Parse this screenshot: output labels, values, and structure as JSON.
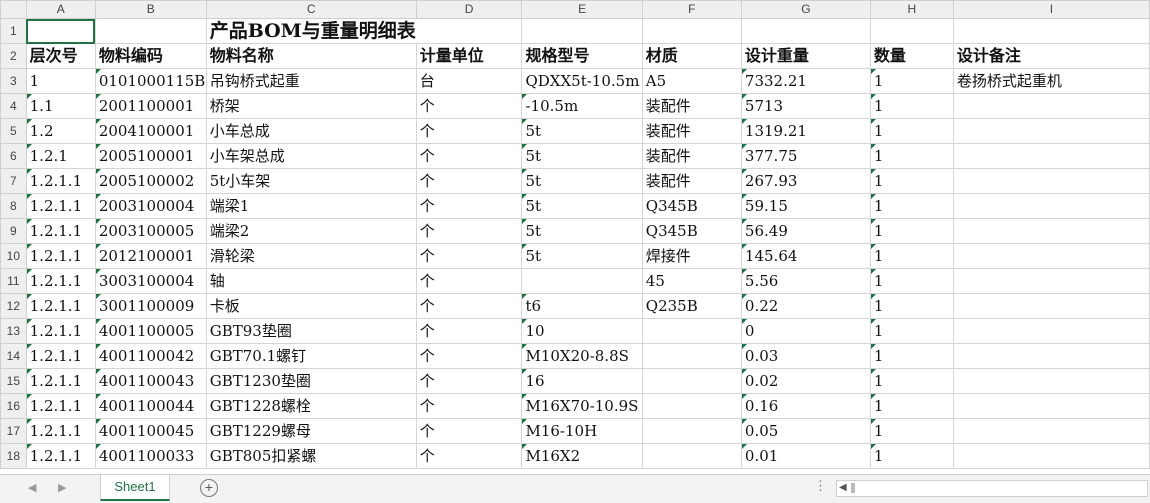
{
  "columns": [
    "A",
    "B",
    "C",
    "D",
    "E",
    "F",
    "G",
    "H",
    "I"
  ],
  "title": "产品BOM与重量明细表",
  "headers": [
    "层次号",
    "物料编码",
    "物料名称",
    "计量单位",
    "规格型号",
    "材质",
    "设计重量",
    "数量",
    "设计备注"
  ],
  "rows": [
    [
      "1",
      "0101000115B",
      "吊钩桥式起重",
      "台",
      "QDXX5t-10.5m",
      "A5",
      "7332.21",
      "1",
      "卷扬桥式起重机"
    ],
    [
      "1.1",
      "2001100001",
      "桥架",
      "个",
      "-10.5m",
      "装配件",
      "5713",
      "1",
      ""
    ],
    [
      "1.2",
      "2004100001",
      "小车总成",
      "个",
      "5t",
      "装配件",
      "1319.21",
      "1",
      ""
    ],
    [
      "1.2.1",
      "2005100001",
      "小车架总成",
      "个",
      "5t",
      "装配件",
      "377.75",
      "1",
      ""
    ],
    [
      "1.2.1.1",
      "2005100002",
      "5t小车架",
      "个",
      "5t",
      "装配件",
      "267.93",
      "1",
      ""
    ],
    [
      "1.2.1.1",
      "2003100004",
      "端梁1",
      "个",
      "5t",
      "Q345B",
      "59.15",
      "1",
      ""
    ],
    [
      "1.2.1.1",
      "2003100005",
      "端梁2",
      "个",
      "5t",
      "Q345B",
      "56.49",
      "1",
      ""
    ],
    [
      "1.2.1.1",
      "2012100001",
      "滑轮梁",
      "个",
      "5t",
      "焊接件",
      "145.64",
      "1",
      ""
    ],
    [
      "1.2.1.1",
      "3003100004",
      "轴",
      "个",
      "",
      "45",
      "5.56",
      "1",
      ""
    ],
    [
      "1.2.1.1",
      "3001100009",
      "卡板",
      "个",
      "t6",
      "Q235B",
      "0.22",
      "1",
      ""
    ],
    [
      "1.2.1.1",
      "4001100005",
      "GBT93垫圈",
      "个",
      "10",
      "",
      "0",
      "1",
      ""
    ],
    [
      "1.2.1.1",
      "4001100042",
      "GBT70.1螺钉",
      "个",
      "M10X20-8.8S",
      "",
      "0.03",
      "1",
      ""
    ],
    [
      "1.2.1.1",
      "4001100043",
      "GBT1230垫圈",
      "个",
      "16",
      "",
      "0.02",
      "1",
      ""
    ],
    [
      "1.2.1.1",
      "4001100044",
      "GBT1228螺栓",
      "个",
      "M16X70-10.9S",
      "",
      "0.16",
      "1",
      ""
    ],
    [
      "1.2.1.1",
      "4001100045",
      "GBT1229螺母",
      "个",
      "M16-10H",
      "",
      "0.05",
      "1",
      ""
    ],
    [
      "1.2.1.1",
      "4001100033",
      "GBT805扣紧螺",
      "个",
      "M16X2",
      "",
      "0.01",
      "1",
      ""
    ]
  ],
  "sheet_tab": "Sheet1",
  "add_sheet_symbol": "+",
  "dots": "⋮",
  "nav_prev": "◀",
  "nav_next": "▶",
  "scroll_left": "◀"
}
